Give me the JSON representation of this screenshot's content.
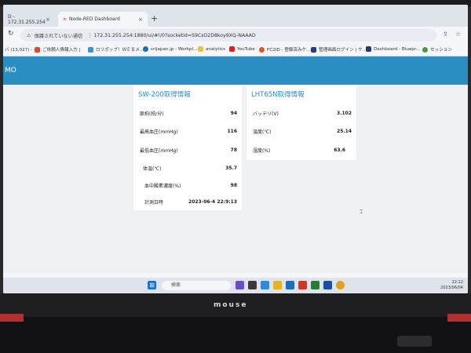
{
  "browser": {
    "tabs": [
      {
        "label": "D - 172.31.255.254"
      },
      {
        "label": "Node-RED Dashboard"
      }
    ],
    "address": {
      "security_text": "保護されていない通信",
      "url": "172.31.255.254:1880/ui/#!/0?socketid=S9CsO2D8koy9XQ-NAAAD"
    },
    "bookmarks": [
      {
        "label": "バ (13,027) -"
      },
      {
        "label": "ご依頼人情報入力 |"
      },
      {
        "label": "ロリポップ！ＷＥＢメ..."
      },
      {
        "label": "crijapan.jp - Workpl..."
      },
      {
        "label": "analytics"
      },
      {
        "label": "YouTube"
      },
      {
        "label": "FC2ID - 登録済みケ..."
      },
      {
        "label": "管理画面ログイン | ケ..."
      },
      {
        "label": "Dashboard - Bluepr..."
      },
      {
        "label": "セッション"
      }
    ]
  },
  "dashboard": {
    "title": "MO",
    "cards": [
      {
        "title": "SW-200取得情報",
        "rows": [
          {
            "label": "脈拍(拍/分)",
            "value": "94"
          },
          {
            "label": "最高血圧(mmHg)",
            "value": "116"
          },
          {
            "label": "最低血圧(mmHg)",
            "value": "78"
          },
          {
            "label": "体温(℃)",
            "value": "35.7"
          },
          {
            "label": "血中酸素濃度(%)",
            "value": "98"
          },
          {
            "label": "計測日時",
            "value": "2023-06-4 22:9:13"
          }
        ]
      },
      {
        "title": "LHT65N取得情報",
        "rows": [
          {
            "label": "バッテリ(V)",
            "value": "3.102"
          },
          {
            "label": "温度(℃)",
            "value": "25.14"
          },
          {
            "label": "湿度(%)",
            "value": "63.6"
          }
        ]
      }
    ]
  },
  "taskbar": {
    "search_placeholder": "検索",
    "time": "22:12",
    "date": "2023/06/04"
  },
  "laptop": {
    "brand": "mouse"
  }
}
